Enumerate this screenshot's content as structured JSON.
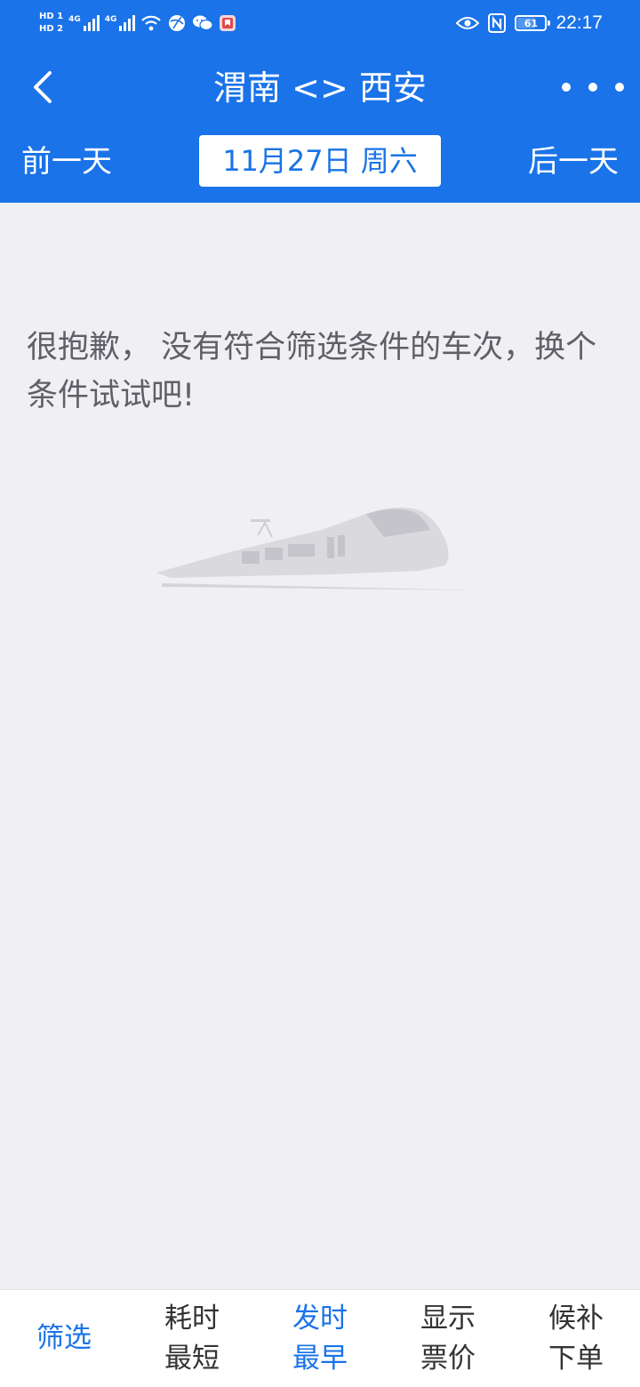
{
  "status_bar": {
    "hd1": "HD 1",
    "hd2": "HD 2",
    "net1": "4G",
    "net2": "4G",
    "battery": "61",
    "battery_level": 0.61,
    "time": "22:17"
  },
  "header": {
    "title": "渭南 <> 西安",
    "prev_day": "前一天",
    "date": "11月27日 周六",
    "next_day": "后一天"
  },
  "main": {
    "empty_message": "很抱歉， 没有符合筛选条件的车次，换个条件试试吧!"
  },
  "bottom_tabs": [
    {
      "line1": "筛选",
      "line2": "",
      "active": true
    },
    {
      "line1": "耗时",
      "line2": "最短",
      "active": false
    },
    {
      "line1": "发时",
      "line2": "最早",
      "active": true
    },
    {
      "line1": "显示",
      "line2": "票价",
      "active": false
    },
    {
      "line1": "候补",
      "line2": "下单",
      "active": false
    }
  ],
  "colors": {
    "brand": "#1a73e8",
    "background": "#efeff4",
    "text_muted": "#5f6066"
  },
  "icons": [
    "back-arrow-icon",
    "more-icon",
    "wifi-icon",
    "eye-icon",
    "nfc-icon",
    "battery-icon",
    "train-icon"
  ]
}
